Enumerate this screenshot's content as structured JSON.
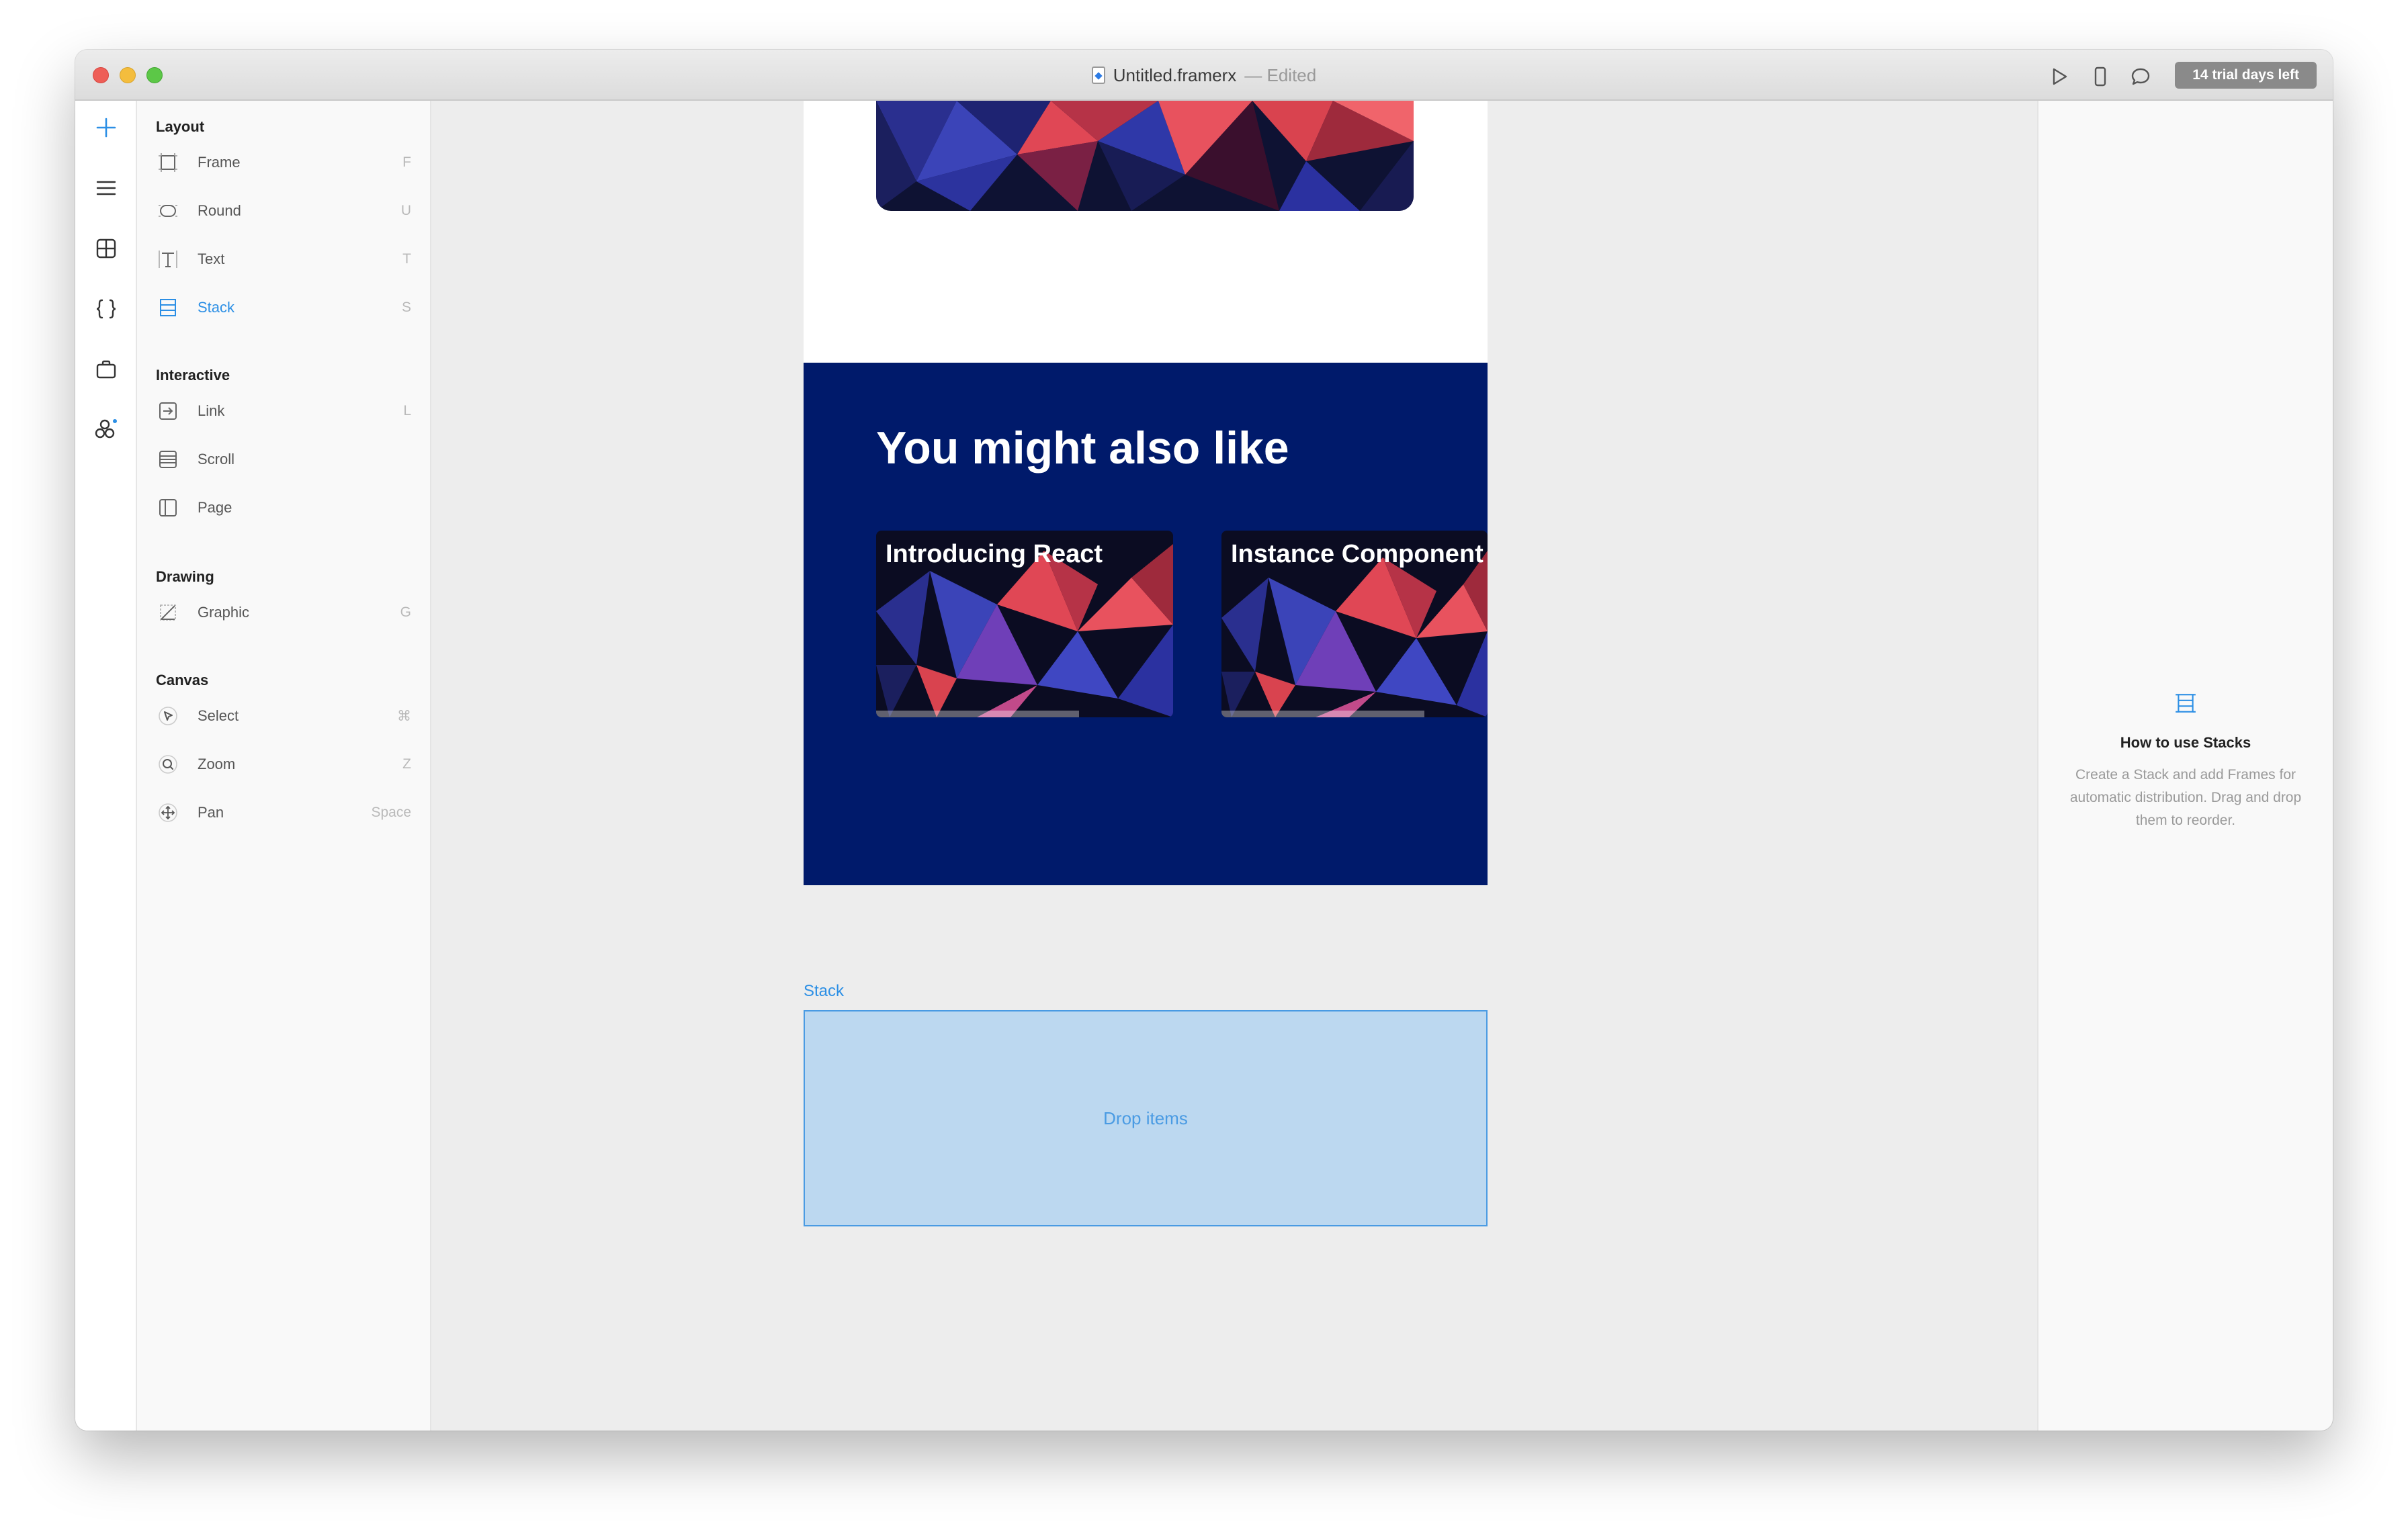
{
  "window": {
    "title": "Untitled.framerx",
    "title_status": "— Edited",
    "trial_badge": "14 trial days left"
  },
  "toolbar": {
    "icons": [
      "play-icon",
      "device-icon",
      "comment-icon"
    ]
  },
  "rail": {
    "icons": [
      "insert-icon",
      "layers-icon",
      "components-icon",
      "code-icon",
      "store-icon",
      "team-icon"
    ]
  },
  "insert_panel": {
    "sections": [
      {
        "title": "Layout",
        "items": [
          {
            "label": "Frame",
            "key": "F"
          },
          {
            "label": "Round",
            "key": "U"
          },
          {
            "label": "Text",
            "key": "T"
          },
          {
            "label": "Stack",
            "key": "S",
            "active": true
          }
        ]
      },
      {
        "title": "Interactive",
        "items": [
          {
            "label": "Link",
            "key": "L"
          },
          {
            "label": "Scroll",
            "key": ""
          },
          {
            "label": "Page",
            "key": ""
          }
        ]
      },
      {
        "title": "Drawing",
        "items": [
          {
            "label": "Graphic",
            "key": "G"
          }
        ]
      },
      {
        "title": "Canvas",
        "items": [
          {
            "label": "Select",
            "key": "⌘"
          },
          {
            "label": "Zoom",
            "key": "Z"
          },
          {
            "label": "Pan",
            "key": "Space"
          }
        ]
      }
    ]
  },
  "canvas": {
    "section_heading": "You might also like",
    "cards": [
      {
        "title": "Introducing React"
      },
      {
        "title": "Instance Component"
      }
    ],
    "stack_label": "Stack",
    "drop_text": "Drop items"
  },
  "help": {
    "title": "How to use Stacks",
    "body": "Create a Stack and add Frames for automatic distribution. Drag and drop them to reorder."
  },
  "colors": {
    "accent": "#2c8fe5",
    "section_bg": "#001a6b",
    "drop_bg": "#bcd8f0"
  }
}
